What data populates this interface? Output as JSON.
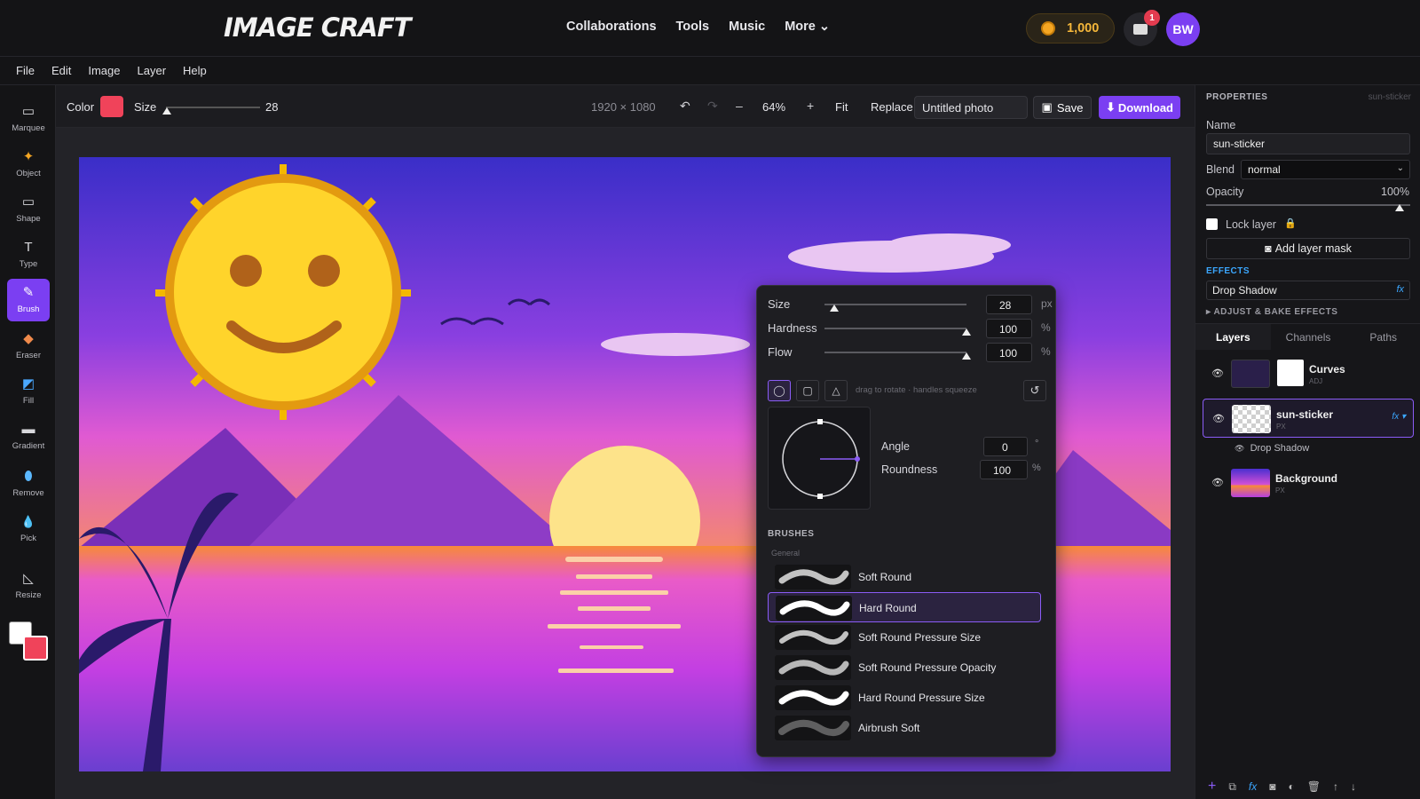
{
  "header": {
    "logo": "IMAGE CRAFT",
    "nav": [
      "Collaborations",
      "Tools",
      "Music",
      "More ⌄"
    ],
    "coins": "1,000",
    "notifications": "1",
    "avatar": "BW"
  },
  "menubar": [
    "File",
    "Edit",
    "Image",
    "Layer",
    "Help"
  ],
  "tools": [
    {
      "label": "Marquee",
      "icon": "marquee-icon",
      "glyph": "▭"
    },
    {
      "label": "Object",
      "icon": "object-icon",
      "glyph": "✦"
    },
    {
      "label": "Shape",
      "icon": "shape-icon",
      "glyph": "▭"
    },
    {
      "label": "Type",
      "icon": "type-icon",
      "glyph": "T"
    },
    {
      "label": "Brush",
      "icon": "brush-icon",
      "glyph": "✎"
    },
    {
      "label": "Eraser",
      "icon": "eraser-icon",
      "glyph": "◆"
    },
    {
      "label": "Fill",
      "icon": "fill-icon",
      "glyph": "◩"
    },
    {
      "label": "Gradient",
      "icon": "gradient-icon",
      "glyph": "▬"
    },
    {
      "label": "Remove",
      "icon": "remove-icon",
      "glyph": "⬮"
    },
    {
      "label": "Pick",
      "icon": "pick-icon",
      "glyph": "💧"
    },
    {
      "label": "Resize",
      "icon": "resize-icon",
      "glyph": "◺"
    }
  ],
  "options": {
    "color_label": "Color",
    "color": "#f0435a",
    "size_label": "Size",
    "size_value": "28",
    "dimensions": "1920 × 1080",
    "zoom_minus": "–",
    "zoom": "64%",
    "zoom_plus": "+",
    "fit": "Fit",
    "replace": "Replace",
    "photo_name": "Untitled photo",
    "save": "Save",
    "download": "Download"
  },
  "brush_panel": {
    "size_label": "Size",
    "size_value": "28",
    "size_unit": "px",
    "hardness_label": "Hardness",
    "hardness_value": "100",
    "hardness_unit": "%",
    "flow_label": "Flow",
    "flow_value": "100",
    "flow_unit": "%",
    "hint": "drag to rotate · handles squeeze",
    "angle_label": "Angle",
    "angle_value": "0",
    "angle_unit": "°",
    "roundness_label": "Roundness",
    "roundness_value": "100",
    "roundness_unit": "%",
    "section": "BRUSHES",
    "group": "General",
    "brushes": [
      "Soft Round",
      "Hard Round",
      "Soft Round Pressure Size",
      "Soft Round Pressure Opacity",
      "Hard Round Pressure Size",
      "Airbrush Soft"
    ],
    "selected": "Hard Round"
  },
  "properties": {
    "title": "PROPERTIES",
    "layer_ref": "sun-sticker",
    "name_label": "Name",
    "name_value": "sun-sticker",
    "blend_label": "Blend",
    "blend_value": "normal",
    "opacity_label": "Opacity",
    "opacity_value": "100%",
    "lock_label": "Lock layer",
    "mask_button": "Add layer mask",
    "effects_title": "EFFECTS",
    "effect": "Drop Shadow",
    "effect_mark": "fx",
    "adjust": "ADJUST & BAKE EFFECTS"
  },
  "layers_tabs": [
    "Layers",
    "Channels",
    "Paths"
  ],
  "layers": [
    {
      "name": "Curves",
      "type": "ADJ"
    },
    {
      "name": "sun-sticker",
      "type": "PX",
      "fx": "fx ▾"
    },
    {
      "name": "Drop Shadow",
      "type": ""
    },
    {
      "name": "Background",
      "type": "PX"
    }
  ]
}
